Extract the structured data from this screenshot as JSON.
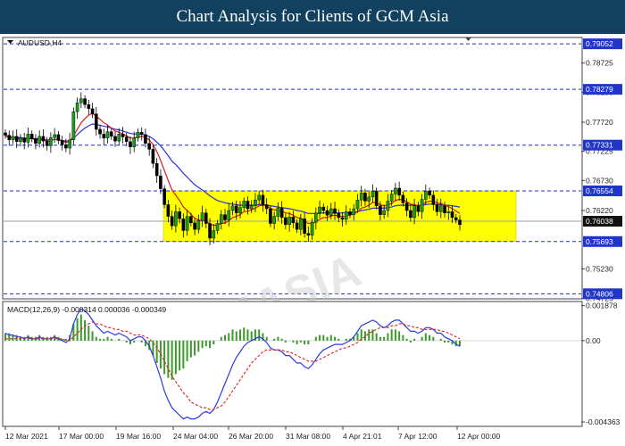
{
  "header": {
    "title": "Chart Analysis for Clients of GCM Asia"
  },
  "watermark": "GCMASIA",
  "colors": {
    "header_bg": "#12405f",
    "zone": "#ffff00",
    "level_line": "#1d2fd0",
    "badge": "#1f36c9",
    "ma_fast": "#d42020",
    "ma_slow": "#2a32d8",
    "macd_line": "#2a3be0",
    "signal_line": "#e02020",
    "histogram": "#3a9a2a",
    "candle": "#1a9a1a"
  },
  "chart_data": [
    {
      "type": "candlestick",
      "title": "AUDUSD,H4",
      "x_tick_labels": [
        "12 Mar 2021",
        "17 Mar 00:00",
        "19 Mar 16:00",
        "24 Mar 04:00",
        "26 Mar 20:00",
        "31 Mar 08:00",
        "4 Apr 21:01",
        "7 Apr 12:00",
        "12 Apr 00:00"
      ],
      "y_tick_labels": [
        "0.78725",
        "0.78230",
        "0.77720",
        "0.77225",
        "0.76730",
        "0.76220",
        "0.75230",
        "0.74725"
      ],
      "ylim": [
        0.7472,
        0.7916
      ],
      "levels": [
        {
          "value": 0.79052,
          "label": "0.79052"
        },
        {
          "value": 0.78279,
          "label": "0.78279"
        },
        {
          "value": 0.77331,
          "label": "0.77331"
        },
        {
          "value": 0.76554,
          "label": "0.76554"
        },
        {
          "value": 0.75693,
          "label": "0.75693"
        },
        {
          "value": 0.74806,
          "label": "0.74806"
        }
      ],
      "current_price": {
        "value": 0.76038,
        "label": "0.76038"
      },
      "zone": {
        "from": 0.75693,
        "to": 0.76554
      },
      "close_series": [
        0.775,
        0.7742,
        0.7748,
        0.7739,
        0.7745,
        0.7738,
        0.7752,
        0.7744,
        0.7736,
        0.7748,
        0.774,
        0.7732,
        0.7746,
        0.7751,
        0.7741,
        0.7734,
        0.7728,
        0.7742,
        0.779,
        0.7805,
        0.7812,
        0.7802,
        0.7795,
        0.7786,
        0.776,
        0.7752,
        0.7745,
        0.7756,
        0.7748,
        0.774,
        0.7752,
        0.7747,
        0.7739,
        0.773,
        0.7745,
        0.7755,
        0.7751,
        0.7736,
        0.7726,
        0.7702,
        0.7681,
        0.7659,
        0.7632,
        0.7612,
        0.7596,
        0.762,
        0.7608,
        0.7588,
        0.7612,
        0.7601,
        0.759,
        0.7605,
        0.7618,
        0.76,
        0.7575,
        0.7588,
        0.76,
        0.7615,
        0.7606,
        0.7622,
        0.763,
        0.7618,
        0.7627,
        0.7638,
        0.7625,
        0.763,
        0.764,
        0.7648,
        0.7632,
        0.7625,
        0.76,
        0.7612,
        0.7626,
        0.761,
        0.7598,
        0.7611,
        0.7601,
        0.759,
        0.7608,
        0.7583,
        0.758,
        0.7602,
        0.7618,
        0.7628,
        0.7622,
        0.7614,
        0.7625,
        0.7617,
        0.761,
        0.7607,
        0.762,
        0.7615,
        0.7625,
        0.764,
        0.7652,
        0.7638,
        0.7645,
        0.7655,
        0.763,
        0.7615,
        0.7622,
        0.7638,
        0.765,
        0.766,
        0.7648,
        0.7635,
        0.7622,
        0.761,
        0.763,
        0.762,
        0.7641,
        0.7655,
        0.7648,
        0.7632,
        0.762,
        0.763,
        0.7618,
        0.762,
        0.761,
        0.7606,
        0.7598
      ],
      "ma_fast": [
        0.775,
        0.7746,
        0.7746,
        0.7744,
        0.7744,
        0.7742,
        0.7744,
        0.7744,
        0.7742,
        0.7743,
        0.7742,
        0.774,
        0.7741,
        0.7743,
        0.7742,
        0.774,
        0.7738,
        0.7739,
        0.7749,
        0.776,
        0.7771,
        0.7778,
        0.7784,
        0.7787,
        0.7782,
        0.7777,
        0.7771,
        0.7767,
        0.7762,
        0.7757,
        0.7755,
        0.7752,
        0.7749,
        0.7745,
        0.7745,
        0.7747,
        0.7748,
        0.7746,
        0.7742,
        0.7734,
        0.7722,
        0.7707,
        0.769,
        0.7673,
        0.7657,
        0.7648,
        0.7639,
        0.7628,
        0.7622,
        0.7616,
        0.7609,
        0.7606,
        0.7606,
        0.7604,
        0.7599,
        0.7597,
        0.7597,
        0.76,
        0.7601,
        0.7605,
        0.761,
        0.7612,
        0.7615,
        0.762,
        0.7621,
        0.7623,
        0.7626,
        0.763,
        0.7631,
        0.763,
        0.7626,
        0.7623,
        0.7623,
        0.7621,
        0.7618,
        0.7617,
        0.7614,
        0.761,
        0.7609,
        0.7604,
        0.76,
        0.76,
        0.7603,
        0.7607,
        0.761,
        0.761,
        0.7613,
        0.7614,
        0.7613,
        0.7612,
        0.7613,
        0.7614,
        0.7616,
        0.762,
        0.7626,
        0.7628,
        0.7631,
        0.7636,
        0.7635,
        0.7632,
        0.763,
        0.7631,
        0.7634,
        0.7639,
        0.7641,
        0.764,
        0.7637,
        0.7633,
        0.7632,
        0.763,
        0.7632,
        0.7636,
        0.7638,
        0.7638,
        0.7635,
        0.7634,
        0.7631,
        0.7629,
        0.7625,
        0.7621,
        0.7617
      ],
      "ma_slow": [
        0.7748,
        0.7747,
        0.7747,
        0.7746,
        0.7746,
        0.7745,
        0.7745,
        0.7745,
        0.7744,
        0.7744,
        0.7743,
        0.7742,
        0.7742,
        0.7743,
        0.7742,
        0.7741,
        0.774,
        0.774,
        0.7745,
        0.7751,
        0.7757,
        0.7762,
        0.7766,
        0.7769,
        0.7768,
        0.7767,
        0.7765,
        0.7764,
        0.7762,
        0.776,
        0.7759,
        0.7757,
        0.7755,
        0.7753,
        0.7752,
        0.7752,
        0.7752,
        0.775,
        0.7748,
        0.7744,
        0.7738,
        0.7732,
        0.7724,
        0.7715,
        0.7706,
        0.77,
        0.7693,
        0.7685,
        0.7679,
        0.7672,
        0.7666,
        0.7661,
        0.7657,
        0.7652,
        0.7647,
        0.7643,
        0.7639,
        0.7637,
        0.7635,
        0.7634,
        0.7633,
        0.7632,
        0.7631,
        0.7631,
        0.7631,
        0.7631,
        0.7631,
        0.7632,
        0.7632,
        0.7631,
        0.763,
        0.7629,
        0.7628,
        0.7627,
        0.7626,
        0.7625,
        0.7624,
        0.7622,
        0.7621,
        0.7619,
        0.7617,
        0.7617,
        0.7617,
        0.7617,
        0.7618,
        0.7618,
        0.7618,
        0.7618,
        0.7618,
        0.7618,
        0.7618,
        0.7618,
        0.7619,
        0.762,
        0.7622,
        0.7623,
        0.7624,
        0.7626,
        0.7626,
        0.7626,
        0.7626,
        0.7627,
        0.7628,
        0.763,
        0.7631,
        0.7631,
        0.7631,
        0.7631,
        0.7631,
        0.7631,
        0.7631,
        0.7632,
        0.7633,
        0.7633,
        0.7632,
        0.7632,
        0.7631,
        0.7631,
        0.763,
        0.7629,
        0.7628
      ]
    },
    {
      "type": "macd",
      "title": "MACD(12,26,9) -0.000314 0.000036 -0.000349",
      "y_tick_labels": [
        "0.001878",
        "0.00",
        "-0.004363"
      ],
      "ylim": [
        -0.0046,
        0.0021
      ],
      "histogram": [
        0.0004,
        0.0004,
        0.0003,
        0.0003,
        0.0002,
        0.0002,
        0.0003,
        0.0002,
        0.0002,
        0.0003,
        0.0002,
        0.0002,
        0.0002,
        0.0003,
        0.0002,
        0.0001,
        0.0001,
        0.0003,
        0.0009,
        0.0012,
        0.0014,
        0.0011,
        0.0008,
        0.0005,
        0.0002,
        0.0001,
        0.0001,
        0.0002,
        0.0001,
        0.0,
        0.0001,
        0.0,
        -0.0001,
        -0.0002,
        -0.0001,
        0.0,
        -0.0001,
        -0.0003,
        -0.0005,
        -0.0008,
        -0.0012,
        -0.0015,
        -0.0018,
        -0.002,
        -0.0021,
        -0.0018,
        -0.0016,
        -0.0015,
        -0.0011,
        -0.0009,
        -0.0008,
        -0.0006,
        -0.0004,
        -0.0003,
        -0.0004,
        -0.0002,
        0.0,
        0.0002,
        0.0003,
        0.0004,
        0.0006,
        0.0005,
        0.0006,
        0.0007,
        0.0006,
        0.0005,
        0.0006,
        0.0006,
        0.0004,
        0.0002,
        0.0,
        0.0001,
        0.0002,
        0.0001,
        -0.0001,
        0.0,
        -0.0001,
        -0.0002,
        -0.0001,
        -0.0002,
        -0.0002,
        0.0,
        0.0002,
        0.0003,
        0.0003,
        0.0002,
        0.0003,
        0.0002,
        0.0001,
        0.0,
        0.0001,
        0.0001,
        0.0002,
        0.0004,
        0.0006,
        0.0005,
        0.0006,
        0.0006,
        0.0004,
        0.0002,
        0.0002,
        0.0004,
        0.0006,
        0.0006,
        0.0005,
        0.0003,
        0.0001,
        -0.0001,
        0.0001,
        0.0,
        0.0002,
        0.0004,
        0.0003,
        0.0002,
        0.0,
        0.0001,
        -0.0001,
        -0.0001,
        -0.0002,
        -0.0003,
        -0.0003
      ],
      "macd_line": [
        0.0004,
        0.0003,
        0.0003,
        0.0002,
        0.0002,
        0.0001,
        0.0002,
        0.0001,
        0.0001,
        0.0002,
        0.0001,
        0.0001,
        0.0001,
        0.0002,
        0.0001,
        0.0,
        -0.0001,
        0.0001,
        0.0009,
        0.0014,
        0.0017,
        0.0016,
        0.0014,
        0.0011,
        0.0008,
        0.0006,
        0.0004,
        0.0005,
        0.0004,
        0.0003,
        0.0004,
        0.0003,
        0.0002,
        0.0,
        0.0001,
        0.0002,
        0.0002,
        0.0,
        -0.0003,
        -0.0008,
        -0.0014,
        -0.002,
        -0.0027,
        -0.0032,
        -0.0036,
        -0.0038,
        -0.004,
        -0.0042,
        -0.0041,
        -0.0042,
        -0.0042,
        -0.0041,
        -0.0039,
        -0.0038,
        -0.0039,
        -0.0037,
        -0.0033,
        -0.0028,
        -0.0023,
        -0.0018,
        -0.0013,
        -0.0009,
        -0.0006,
        -0.0003,
        -0.0001,
        0.0,
        0.0001,
        0.0002,
        0.0001,
        -0.0001,
        -0.0004,
        -0.0005,
        -0.0005,
        -0.0006,
        -0.0008,
        -0.0008,
        -0.001,
        -0.0012,
        -0.0012,
        -0.0014,
        -0.0015,
        -0.0013,
        -0.001,
        -0.0007,
        -0.0005,
        -0.0004,
        -0.0003,
        -0.0002,
        -0.0002,
        -0.0002,
        -0.0001,
        0.0,
        0.0002,
        0.0005,
        0.0008,
        0.0009,
        0.001,
        0.0011,
        0.001,
        0.0008,
        0.0007,
        0.0008,
        0.001,
        0.0011,
        0.0011,
        0.0009,
        0.0007,
        0.0005,
        0.0005,
        0.0004,
        0.0005,
        0.0007,
        0.0007,
        0.0006,
        0.0004,
        0.0004,
        0.0002,
        0.0001,
        0.0,
        -0.0002,
        -0.0003
      ],
      "signal_line": [
        0.0001,
        0.0001,
        0.0001,
        0.0001,
        0.0001,
        0.0001,
        0.0001,
        0.0001,
        0.0001,
        0.0001,
        0.0001,
        0.0001,
        0.0001,
        0.0001,
        0.0001,
        0.0001,
        0.0,
        0.0,
        0.0002,
        0.0004,
        0.0006,
        0.0008,
        0.0009,
        0.001,
        0.0009,
        0.0009,
        0.0008,
        0.0007,
        0.0007,
        0.0006,
        0.0006,
        0.0005,
        0.0005,
        0.0004,
        0.0003,
        0.0003,
        0.0003,
        0.0002,
        0.0001,
        -0.0001,
        -0.0004,
        -0.0007,
        -0.0011,
        -0.0015,
        -0.0019,
        -0.0022,
        -0.0025,
        -0.0028,
        -0.003,
        -0.0033,
        -0.0034,
        -0.0035,
        -0.0036,
        -0.0036,
        -0.0037,
        -0.0037,
        -0.0036,
        -0.0035,
        -0.0033,
        -0.003,
        -0.0027,
        -0.0024,
        -0.0021,
        -0.0018,
        -0.0015,
        -0.0012,
        -0.001,
        -0.0008,
        -0.0006,
        -0.0005,
        -0.0005,
        -0.0005,
        -0.0005,
        -0.0005,
        -0.0006,
        -0.0006,
        -0.0007,
        -0.0008,
        -0.0009,
        -0.001,
        -0.0011,
        -0.0011,
        -0.0011,
        -0.001,
        -0.0009,
        -0.0008,
        -0.0007,
        -0.0006,
        -0.0005,
        -0.0004,
        -0.0004,
        -0.0003,
        -0.0002,
        -0.0001,
        0.0001,
        0.0002,
        0.0004,
        0.0005,
        0.0006,
        0.0007,
        0.0007,
        0.0007,
        0.0008,
        0.0008,
        0.0009,
        0.0009,
        0.0008,
        0.0008,
        0.0007,
        0.0007,
        0.0006,
        0.0006,
        0.0006,
        0.0006,
        0.0006,
        0.0005,
        0.0005,
        0.0004,
        0.0003,
        0.0002,
        0.0001
      ]
    }
  ]
}
